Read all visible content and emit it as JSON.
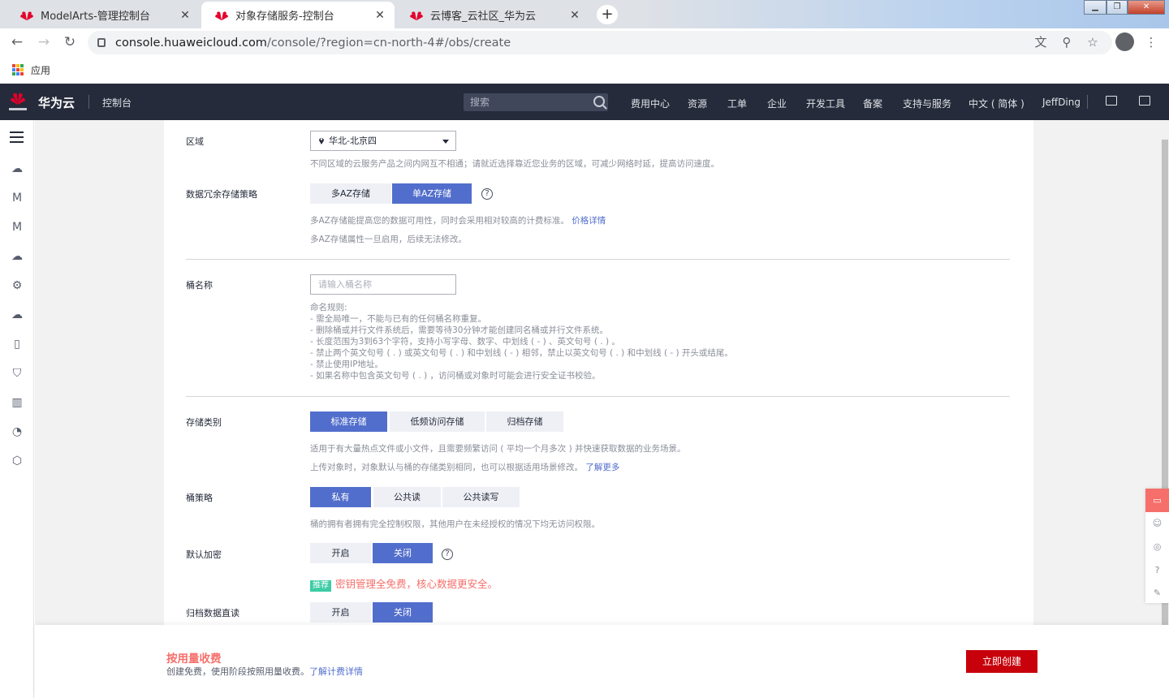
{
  "browser": {
    "tabs": [
      {
        "label": "ModelArts-管理控制台",
        "active": false
      },
      {
        "label": "对象存储服务-控制台",
        "active": true
      },
      {
        "label": "云博客_云社区_华为云",
        "active": false
      }
    ],
    "url_host": "console.huaweicloud.com",
    "url_path": "/console/?region=cn-north-4#/obs/create",
    "bookmarks_apps": "应用"
  },
  "header": {
    "brand": "华为云",
    "console": "控制台",
    "search_placeholder": "搜索",
    "nav": [
      "费用中心",
      "资源",
      "工单",
      "企业",
      "开发工具",
      "备案",
      "支持与服务",
      "中文 ( 简体 )",
      "JeffDing"
    ]
  },
  "form": {
    "region": {
      "label": "区域",
      "value": "华北-北京四",
      "hint": "不同区域的云服务产品之间内网互不相通；请就近选择靠近您业务的区域，可减少网络时延，提高访问速度。"
    },
    "redundancy": {
      "label": "数据冗余存储策略",
      "options": [
        "多AZ存储",
        "单AZ存储"
      ],
      "selected": "单AZ存储",
      "hint1": "多AZ存储能提高您的数据可用性，同时会采用相对较高的计费标准。",
      "hint1_link": "价格详情",
      "hint2": "多AZ存储属性一旦启用，后续无法修改。"
    },
    "bucket_name": {
      "label": "桶名称",
      "placeholder": "请输入桶名称",
      "rules": [
        "命名规则:",
        "- 需全局唯一，不能与已有的任何桶名称重复。",
        "- 删除桶或并行文件系统后，需要等待30分钟才能创建同名桶或并行文件系统。",
        "- 长度范围为3到63个字符，支持小写字母、数字、中划线 ( - ) 、英文句号 ( . ) 。",
        "- 禁止两个英文句号 ( . ) 或英文句号 ( . ) 和中划线 ( - ) 相邻，禁止以英文句号 ( . ) 和中划线 ( - ) 开头或结尾。",
        "- 禁止使用IP地址。",
        "- 如果名称中包含英文句号 ( . ) ，访问桶或对象时可能会进行安全证书校验。"
      ]
    },
    "storage_class": {
      "label": "存储类别",
      "options": [
        "标准存储",
        "低频访问存储",
        "归档存储"
      ],
      "selected": "标准存储",
      "hint1": "适用于有大量热点文件或小文件，且需要频繁访问 ( 平均一个月多次 ) 并快速获取数据的业务场景。",
      "hint2": "上传对象时，对象默认与桶的存储类别相同，也可以根据适用场景修改。",
      "hint2_link": "了解更多"
    },
    "bucket_policy": {
      "label": "桶策略",
      "options": [
        "私有",
        "公共读",
        "公共读写"
      ],
      "selected": "私有",
      "hint": "桶的拥有者拥有完全控制权限，其他用户在未经授权的情况下均无访问权限。"
    },
    "encryption": {
      "label": "默认加密",
      "options": [
        "开启",
        "关闭"
      ],
      "selected": "关闭",
      "tag": "推荐",
      "promo": "密钥管理全免费，核心数据更安全。"
    },
    "archive_read": {
      "label": "归档数据直读",
      "options": [
        "开启",
        "关闭"
      ],
      "selected": "关闭"
    }
  },
  "footer": {
    "fee_title": "按用量收费",
    "fee_desc": "创建免费，使用阶段按照用量收费。",
    "fee_link": "了解计费详情",
    "create_button": "立即创建"
  },
  "colors": {
    "header_bg": "#252b3a",
    "accent": "#526ecc",
    "primary_button": "#c7000b",
    "promo": "#f66f6a",
    "tag": "#3dcca6"
  }
}
